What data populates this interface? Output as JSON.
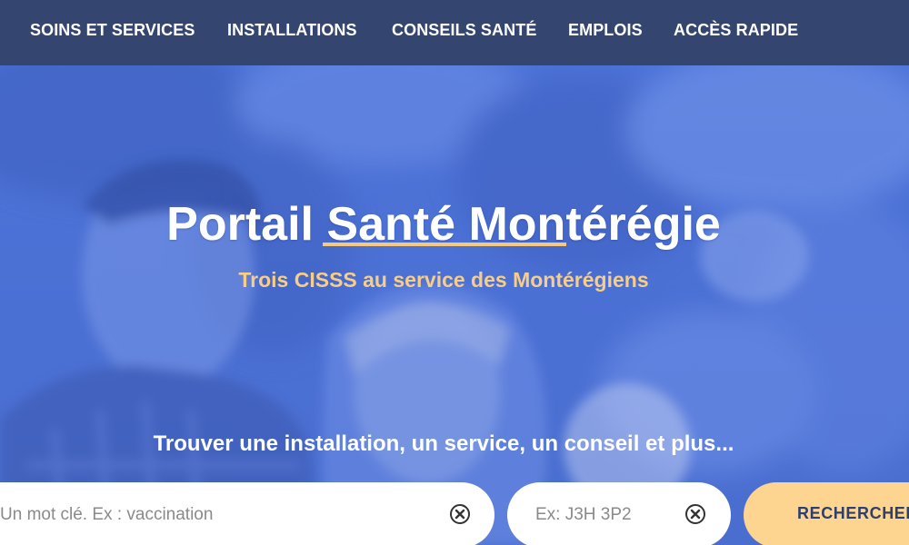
{
  "nav": {
    "items": [
      {
        "label": "SOINS ET SERVICES"
      },
      {
        "label": "INSTALLATIONS"
      },
      {
        "label": "CONSEILS SANTÉ"
      },
      {
        "label": "EMPLOIS"
      },
      {
        "label": "ACCÈS RAPIDE"
      }
    ]
  },
  "hero": {
    "title": "Portail Santé Montérégie",
    "subtitle": "Trois CISSS au service des Montérégiens",
    "search_heading": "Trouver une installation, un service, un conseil et plus..."
  },
  "search": {
    "keyword": {
      "value": "",
      "placeholder": "Un mot clé. Ex : vaccination"
    },
    "postal": {
      "value": "",
      "placeholder": "Ex: J3H 3P2"
    },
    "button_label": "RECHERCHER",
    "clear_icon": "circle-x-icon"
  },
  "colors": {
    "nav_bg": "#34466f",
    "hero_overlay": "#4a6fd6",
    "accent": "#f7c97c",
    "button_bg": "#fdd490",
    "button_text": "#2f3f6a"
  }
}
